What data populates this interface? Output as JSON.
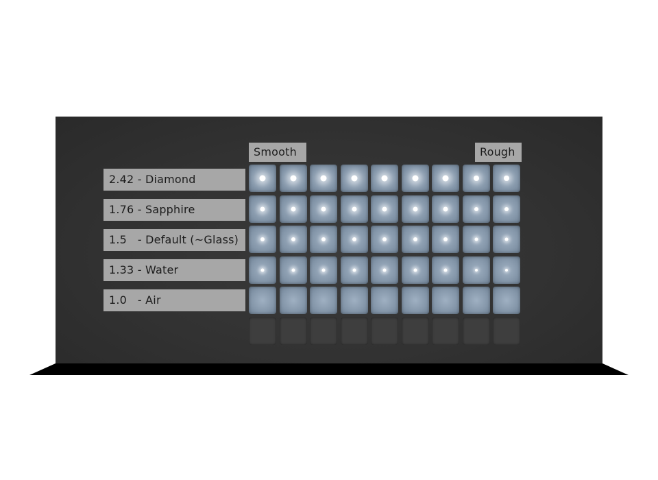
{
  "scene": {
    "axis_labels": {
      "left": "Smooth",
      "right": "Rough"
    },
    "rows": [
      {
        "label": "2.42 - Diamond",
        "highlight": true
      },
      {
        "label": "1.76 - Sapphire",
        "highlight": true
      },
      {
        "label": "1.5   - Default (~Glass)",
        "highlight": true
      },
      {
        "label": "1.33 - Water",
        "highlight": true
      },
      {
        "label": "1.0   - Air",
        "highlight": false
      }
    ],
    "columns_per_row": 9,
    "extra_empty_row": true,
    "colors": {
      "backdrop": "#323232",
      "tile": "#8496a9",
      "label_bg": "#a7a7a7",
      "highlight": "#ffffff"
    }
  }
}
